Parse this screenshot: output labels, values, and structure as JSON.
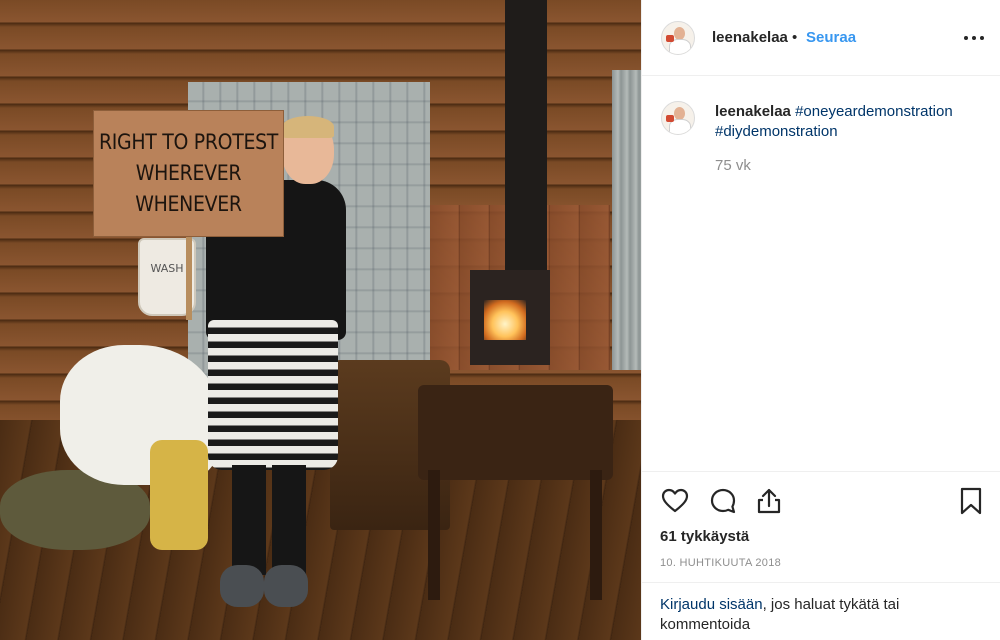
{
  "post": {
    "sign_lines": [
      "RIGHT TO PROTEST",
      "WHEREVER",
      "WHENEVER"
    ],
    "bucket_text": "WASH"
  },
  "header": {
    "username": "leenakelaa",
    "separator": "•",
    "follow_label": "Seuraa",
    "more_icon": "more-horizontal-icon"
  },
  "caption": {
    "username": "leenakelaa",
    "hashtags": [
      "#oneyeardemonstration",
      "#diydemonstration"
    ],
    "time_ago": "75 vk"
  },
  "actions": {
    "like_icon": "heart-icon",
    "comment_icon": "comment-icon",
    "share_icon": "share-icon",
    "save_icon": "bookmark-icon",
    "likes": "61 tykkäystä",
    "date": "10. HUHTIKUUTA 2018"
  },
  "login": {
    "link_text": "Kirjaudu sisään",
    "rest_text": ", jos haluat tykätä tai kommentoida"
  },
  "colors": {
    "accent_blue": "#3897f0",
    "link_dark_blue": "#003569",
    "text": "#262626",
    "muted": "#8e8e8e",
    "divider": "#efefef"
  }
}
